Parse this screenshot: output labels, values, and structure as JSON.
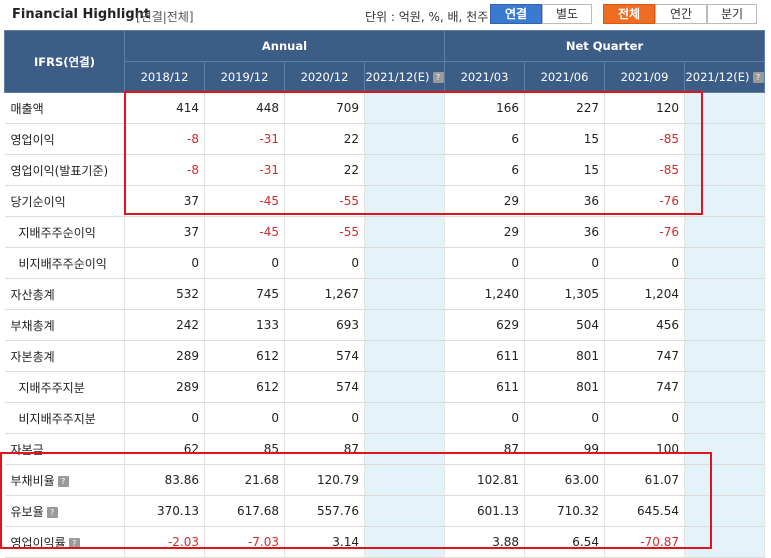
{
  "header": {
    "title": "Financial Highlight",
    "subtitle": "[연결|전체]",
    "unit_label": "단위 : 억원, %, 배, 천주",
    "scope_buttons": [
      "연결",
      "별도"
    ],
    "period_buttons": [
      "전체",
      "연간",
      "분기"
    ]
  },
  "table": {
    "ifrs_label": "IFRS(연결)",
    "group_annual": "Annual",
    "group_quarter": "Net Quarter",
    "columns": [
      "2018/12",
      "2019/12",
      "2020/12",
      "2021/12(E)",
      "2021/03",
      "2021/06",
      "2021/09",
      "2021/12(E)"
    ],
    "rows": [
      {
        "label": "매출액",
        "values": [
          "414",
          "448",
          "709",
          "",
          "166",
          "227",
          "120",
          ""
        ]
      },
      {
        "label": "영업이익",
        "values": [
          "-8",
          "-31",
          "22",
          "",
          "6",
          "15",
          "-85",
          ""
        ]
      },
      {
        "label": "영업이익(발표기준)",
        "values": [
          "-8",
          "-31",
          "22",
          "",
          "6",
          "15",
          "-85",
          ""
        ]
      },
      {
        "label": "당기순이익",
        "values": [
          "37",
          "-45",
          "-55",
          "",
          "29",
          "36",
          "-76",
          ""
        ]
      },
      {
        "label": "지배주주순이익",
        "values": [
          "37",
          "-45",
          "-55",
          "",
          "29",
          "36",
          "-76",
          ""
        ]
      },
      {
        "label": "비지배주주순이익",
        "values": [
          "0",
          "0",
          "0",
          "",
          "0",
          "0",
          "0",
          ""
        ]
      },
      {
        "label": "자산총계",
        "values": [
          "532",
          "745",
          "1,267",
          "",
          "1,240",
          "1,305",
          "1,204",
          ""
        ]
      },
      {
        "label": "부채총계",
        "values": [
          "242",
          "133",
          "693",
          "",
          "629",
          "504",
          "456",
          ""
        ]
      },
      {
        "label": "자본총계",
        "values": [
          "289",
          "612",
          "574",
          "",
          "611",
          "801",
          "747",
          ""
        ]
      },
      {
        "label": "지배주주지분",
        "values": [
          "289",
          "612",
          "574",
          "",
          "611",
          "801",
          "747",
          ""
        ]
      },
      {
        "label": "비지배주주지분",
        "values": [
          "0",
          "0",
          "0",
          "",
          "0",
          "0",
          "0",
          ""
        ]
      },
      {
        "label": "자본금",
        "values": [
          "62",
          "85",
          "87",
          "",
          "87",
          "99",
          "100",
          ""
        ]
      },
      {
        "label": "부채비율",
        "values": [
          "83.86",
          "21.68",
          "120.79",
          "",
          "102.81",
          "63.00",
          "61.07",
          ""
        ]
      },
      {
        "label": "유보율",
        "values": [
          "370.13",
          "617.68",
          "557.76",
          "",
          "601.13",
          "710.32",
          "645.54",
          ""
        ]
      },
      {
        "label": "영업이익률",
        "values": [
          "-2.03",
          "-7.03",
          "3.14",
          "",
          "3.88",
          "6.54",
          "-70.87",
          ""
        ]
      }
    ]
  },
  "colors": {
    "header_bg": "#3c5d86",
    "negative": "#d22b2b",
    "estimate_bg": "#e4f2fa",
    "highlight_box": "#e0141e"
  },
  "icons": {
    "help": "question-icon"
  }
}
